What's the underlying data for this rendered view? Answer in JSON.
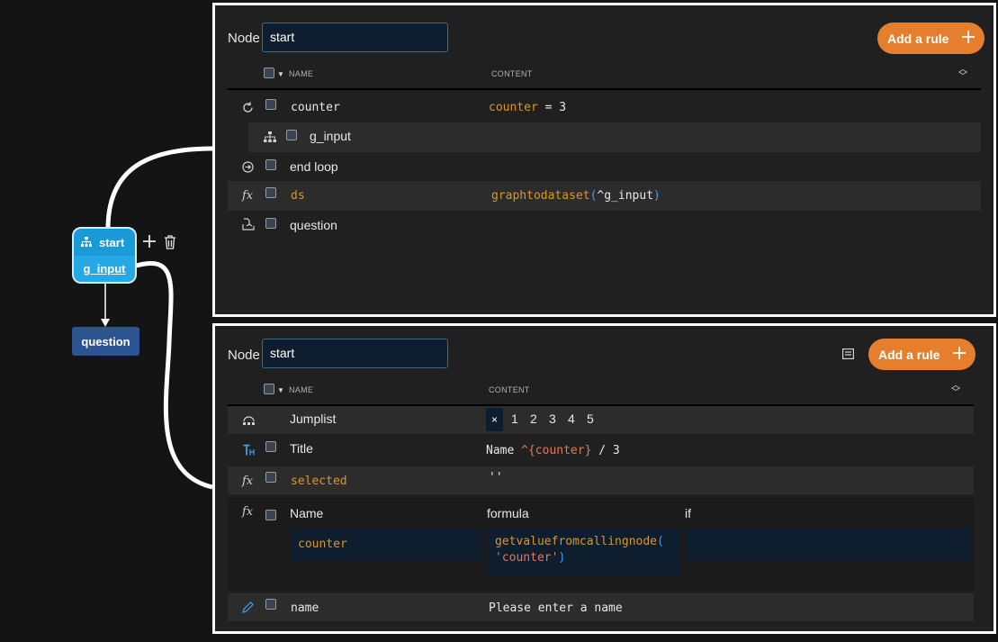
{
  "graph": {
    "start_node": {
      "title": "start",
      "subtitle": "g_input"
    },
    "question_node": {
      "label": "question"
    },
    "tools": {
      "add_icon": "plus-icon",
      "delete_icon": "trash-icon"
    }
  },
  "top_panel": {
    "node_label": "Node",
    "node_value": "start",
    "add_rule_label": "Add a rule",
    "columns": {
      "name": "NAME",
      "content": "CONTENT"
    },
    "rows": [
      {
        "icon": "loop-icon",
        "name": "counter",
        "content_var": "counter",
        "content_op": " = ",
        "content_val": "3"
      },
      {
        "icon": "hierarchy-icon",
        "name": "g_input"
      },
      {
        "icon": "end-loop-icon",
        "name": "end loop"
      },
      {
        "icon": "function-icon",
        "name": "ds",
        "content_fn": "graphtodataset",
        "content_paren_open": "(",
        "content_arg": "^g_input",
        "content_paren_close": ")"
      },
      {
        "icon": "question-icon",
        "name": "question"
      }
    ]
  },
  "bottom_panel": {
    "node_label": "Node",
    "node_value": "start",
    "add_rule_label": "Add a rule",
    "columns": {
      "name": "NAME",
      "content": "CONTENT"
    },
    "jumplist": {
      "name": "Jumplist",
      "close": "×",
      "items": [
        "1",
        "2",
        "3",
        "4",
        "5"
      ]
    },
    "title_row": {
      "name": "Title",
      "content_a": "Name ",
      "content_var": "^{counter}",
      "content_b": " / 3"
    },
    "selected_row": {
      "name": "selected",
      "content": "''"
    },
    "formula_row": {
      "name_header": "Name",
      "formula_header": "formula",
      "if_header": "if",
      "name_value": "counter",
      "formula_fn": "getvaluefromcallingnode",
      "formula_paren_open": "(",
      "formula_arg": "'counter'",
      "formula_paren_close": ")",
      "if_value": ""
    },
    "name_row": {
      "name": "name",
      "content": "Please enter a name"
    }
  },
  "colors": {
    "accent": "#e57f2e",
    "node_blue": "#1a9ad6",
    "question_node": "#2c5490",
    "variable": "#d8962f"
  }
}
